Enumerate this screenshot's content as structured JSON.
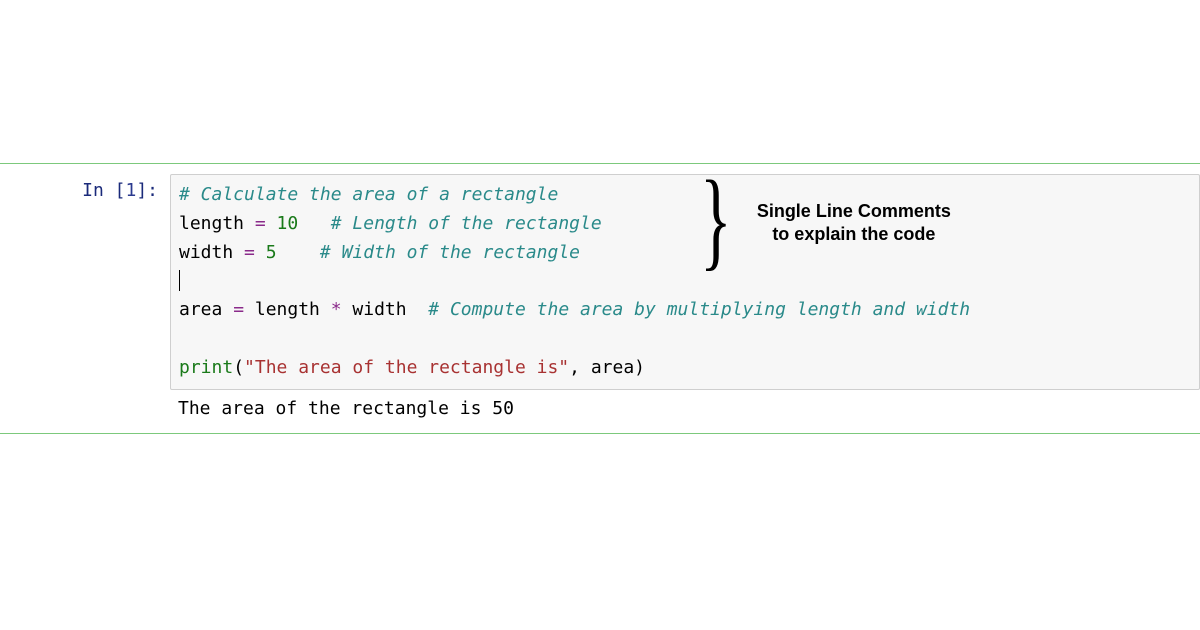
{
  "cell": {
    "prompt_in": "In ",
    "prompt_open": "[",
    "prompt_num": "1",
    "prompt_close": "]:",
    "code": {
      "line1_comment": "# Calculate the area of a rectangle",
      "line2_var": "length ",
      "line2_op": "=",
      "line2_sp": " ",
      "line2_num": "10",
      "line2_gap": "   ",
      "line2_comment": "# Length of the rectangle",
      "line3_var": "width ",
      "line3_op": "=",
      "line3_sp": " ",
      "line3_num": "5",
      "line3_gap": "    ",
      "line3_comment": "# Width of the rectangle",
      "line5_var1": "area ",
      "line5_op1": "=",
      "line5_mid1": " length ",
      "line5_op2": "*",
      "line5_mid2": " width  ",
      "line5_comment": "# Compute the area by multiplying length and width",
      "line7_builtin": "print",
      "line7_open": "(",
      "line7_str": "\"The area of the rectangle is\"",
      "line7_rest": ", area)",
      "nl": "\n"
    },
    "output": "The area of the rectangle is 50"
  },
  "annotation": {
    "brace": "}",
    "text": "Single Line Comments\n to explain the code"
  }
}
